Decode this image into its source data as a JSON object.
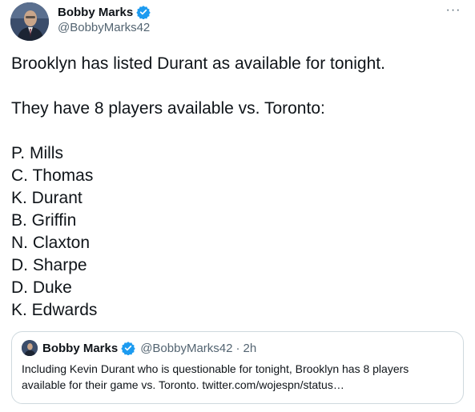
{
  "author": {
    "display_name": "Bobby Marks",
    "handle": "@BobbyMarks42",
    "verified": true,
    "avatar_icon": "profile-photo"
  },
  "more_label": "···",
  "tweet": {
    "line1": "Brooklyn has listed Durant as available for tonight.",
    "line2": "They have 8 players available vs. Toronto:",
    "players": [
      "P. Mills",
      "C. Thomas",
      "K. Durant",
      "B. Griffin",
      "N. Claxton",
      "D. Sharpe",
      "D. Duke",
      "K. Edwards"
    ]
  },
  "quoted_tweet": {
    "display_name": "Bobby Marks",
    "handle": "@BobbyMarks42",
    "separator": "·",
    "time": "2h",
    "text": "Including Kevin Durant who is questionable for tonight, Brooklyn has 8 players available for their game vs. Toronto. twitter.com/wojespn/status…"
  },
  "colors": {
    "verified_blue": "#1d9bf0",
    "secondary_text": "#536471",
    "border": "#cfd9de"
  }
}
